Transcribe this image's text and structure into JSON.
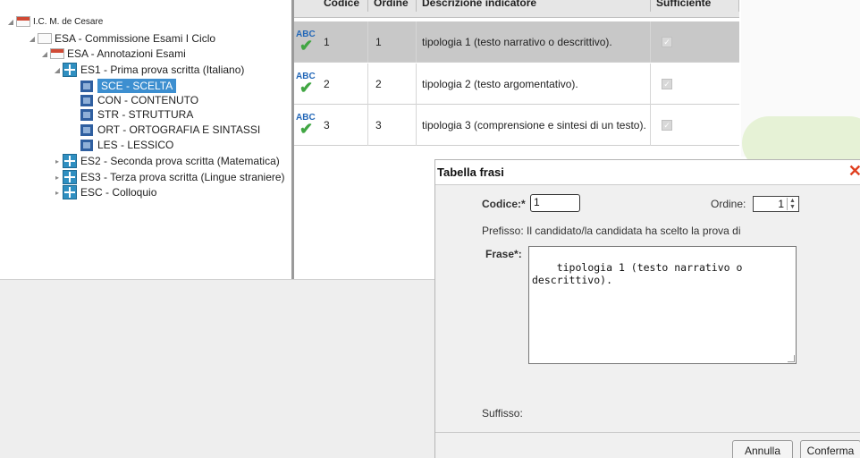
{
  "tree": {
    "root": "I.C. M. de Cesare",
    "commission": "ESA - Commissione Esami I Ciclo",
    "annotations": "ESA - Annotazioni Esami",
    "es1": "ES1 - Prima prova scritta (Italiano)",
    "es1_children": [
      "SCE - SCELTA",
      "CON - CONTENUTO",
      "STR - STRUTTURA",
      "ORT - ORTOGRAFIA E SINTASSI",
      "LES - LESSICO"
    ],
    "es2": "ES2 - Seconda prova scritta (Matematica)",
    "es3": "ES3 - Terza prova scritta (Lingue straniere)",
    "esc": "ESC - Colloquio"
  },
  "grid": {
    "headers": [
      "Codice",
      "Ordine",
      "Descrizione indicatore",
      "Sufficiente"
    ],
    "icon_text": "ABC",
    "rows": [
      {
        "codice": "1",
        "ordine": "1",
        "descrizione": "tipologia 1 (testo narrativo o descrittivo).",
        "selected": true
      },
      {
        "codice": "2",
        "ordine": "2",
        "descrizione": "tipologia 2 (testo argomentativo).",
        "selected": false
      },
      {
        "codice": "3",
        "ordine": "3",
        "descrizione": "tipologia 3 (comprensione e sintesi di un testo).",
        "selected": false
      }
    ]
  },
  "dialog": {
    "title": "Tabella frasi",
    "codice_label": "Codice:*",
    "codice_value": "1",
    "ordine_label": "Ordine:",
    "ordine_value": "1",
    "prefisso": "Prefisso: Il candidato/la candidata ha scelto la prova di",
    "frase_label": "Frase*:",
    "frase_value": "tipologia 1 (testo narrativo o\ndescrittivo).",
    "suffisso_label": "Suffisso:",
    "annulla": "Annulla",
    "conferma": "Conferma"
  },
  "colors": {
    "selection": "#3d8fd0",
    "check_green": "#41a643",
    "close_red": "#e04020"
  }
}
